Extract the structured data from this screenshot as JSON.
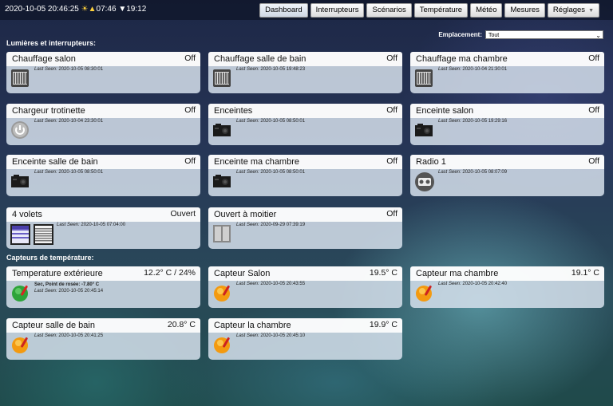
{
  "header": {
    "datetime": "2020-10-05 20:46:25",
    "sunrise": "07:46",
    "sunset": "19:12",
    "nav": [
      "Dashboard",
      "Interrupteurs",
      "Scénarios",
      "Température",
      "Météo",
      "Mesures",
      "Réglages"
    ]
  },
  "filter": {
    "label": "Emplacement:",
    "value": "Tout"
  },
  "sections": {
    "lights": "Lumières et interrupteurs:",
    "temps": "Capteurs de température:"
  },
  "last_seen_label": "Last Seen:",
  "devices": [
    {
      "name": "Chauffage salon",
      "status": "Off",
      "seen": "2020-10-05 08:30:01",
      "icon": "radiator-icon"
    },
    {
      "name": "Chauffage salle de bain",
      "status": "Off",
      "seen": "2020-10-05 19:48:23",
      "icon": "radiator-icon"
    },
    {
      "name": "Chauffage ma chambre",
      "status": "Off",
      "seen": "2020-10-04 21:30:01",
      "icon": "radiator-icon"
    },
    {
      "name": "Chargeur trotinette",
      "status": "Off",
      "seen": "2020-10-04 23:30:01",
      "icon": "power-icon"
    },
    {
      "name": "Enceintes",
      "status": "Off",
      "seen": "2020-10-05 08:50:01",
      "icon": "speaker-icon"
    },
    {
      "name": "Enceinte salon",
      "status": "Off",
      "seen": "2020-10-05 19:29:16",
      "icon": "speaker-icon"
    },
    {
      "name": "Enceinte salle de bain",
      "status": "Off",
      "seen": "2020-10-05 08:50:01",
      "icon": "speaker-icon"
    },
    {
      "name": "Enceinte ma chambre",
      "status": "Off",
      "seen": "2020-10-05 08:50:01",
      "icon": "speaker-icon"
    },
    {
      "name": "Radio 1",
      "status": "Off",
      "seen": "2020-10-05 08:07:09",
      "icon": "radio-icon"
    },
    {
      "name": "4 volets",
      "status": "Ouvert",
      "seen": "2020-10-05 07:04:00",
      "icon": "blinds-icon"
    },
    {
      "name": "Ouvert à moitier",
      "status": "Off",
      "seen": "2020-09-29 07:39:19",
      "icon": "door-icon"
    }
  ],
  "sensors": [
    {
      "name": "Temperature extérieure",
      "status": "12.2° C / 24%",
      "seen": "2020-10-05 20:45:14",
      "dew": "Sec, Point de rosée: -7.80° C",
      "icon": "thermo-green-icon"
    },
    {
      "name": "Capteur Salon",
      "status": "19.5° C",
      "seen": "2020-10-05 20:43:55",
      "icon": "thermo-orange-icon"
    },
    {
      "name": "Capteur ma chambre",
      "status": "19.1° C",
      "seen": "2020-10-05 20:42:40",
      "icon": "thermo-orange-icon"
    },
    {
      "name": "Capteur salle de bain",
      "status": "20.8° C",
      "seen": "2020-10-05 20:41:25",
      "icon": "thermo-orange-icon"
    },
    {
      "name": "Capteur la chambre",
      "status": "19.9° C",
      "seen": "2020-10-05 20:45:10",
      "icon": "thermo-orange-icon"
    }
  ]
}
